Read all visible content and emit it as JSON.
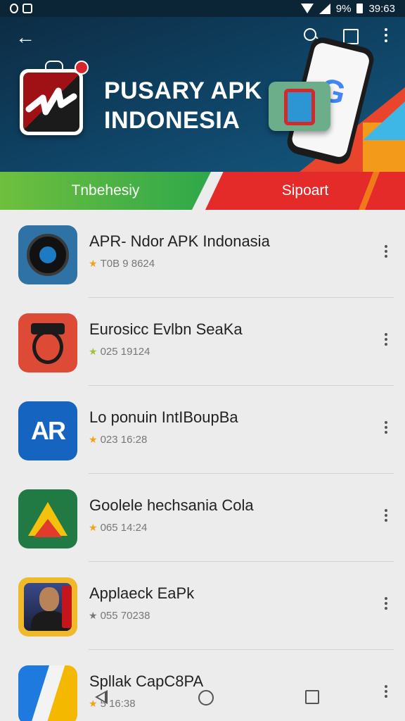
{
  "status_bar": {
    "battery_text": "9%",
    "time": "39:63",
    "icons": [
      "circle-notification-icon",
      "square-notification-icon",
      "wifi-icon",
      "signal-icon",
      "battery-icon"
    ]
  },
  "header": {
    "title_line1": "PUSARY APK",
    "title_line2": "INDONESIA",
    "icons": [
      "back-arrow-icon",
      "search-icon",
      "square-icon",
      "more-vert-icon"
    ],
    "colors": {
      "background": "#0f4466",
      "accent_red": "#e8452c",
      "accent_blue": "#3fb7e6"
    }
  },
  "tabs": [
    {
      "label": "Tnbehesiy",
      "color": "#3aaa48"
    },
    {
      "label": "Sipoart",
      "color": "#e52a2a"
    }
  ],
  "apps": [
    {
      "title": "APR- Ndor APK Indonasia",
      "meta": "T0B 9 8624",
      "star_color": "#f3a21a",
      "icon": "camera-lens-icon"
    },
    {
      "title": "Eurosicc Evlbn SeaKa",
      "meta": "025 19124",
      "star_color": "#a3c23a",
      "icon": "ring-clip-icon"
    },
    {
      "title": "Lo ponuin IntIBoupBa",
      "meta": "023 16:28",
      "star_color": "#f3a21a",
      "icon_text": "AR",
      "icon": "ap-logo-icon"
    },
    {
      "title": "Goolele hechsania Cola",
      "meta": "065 14:24",
      "star_color": "#f3a21a",
      "icon": "drive-triangle-icon"
    },
    {
      "title": "Applaeck EaPk",
      "meta": "055 70238",
      "star_color": "#777777",
      "icon": "person-photo-icon"
    },
    {
      "title": "Spllak CapC8PA",
      "meta": "5 16:38",
      "star_color": "#f3a21a",
      "icon": "split-shape-icon"
    }
  ],
  "star_glyph": "★",
  "nav_bar": {
    "icons": [
      "nav-back-icon",
      "nav-home-icon",
      "nav-recent-icon"
    ]
  }
}
